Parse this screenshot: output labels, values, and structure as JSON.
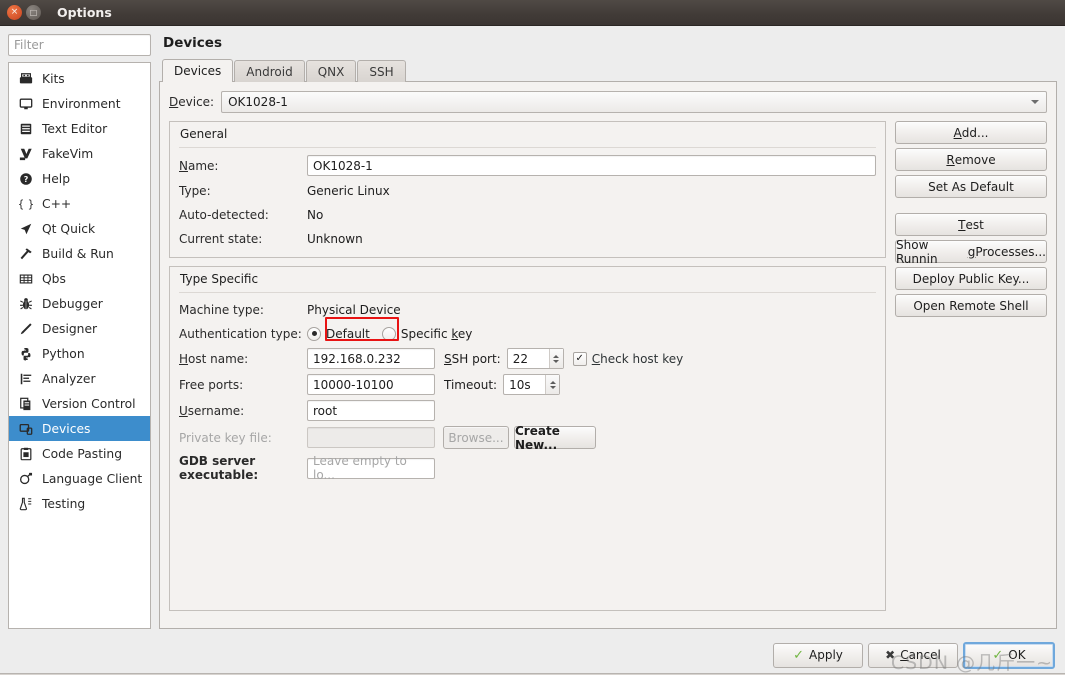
{
  "window": {
    "title": "Options",
    "close_glyph": "×",
    "maximize_glyph": "□"
  },
  "colors": {
    "selection": "#3d8dcc",
    "highlight_box": "#e81313",
    "titlebar": "#413b37",
    "accent_check": "#72b642"
  },
  "sidebar": {
    "filter_placeholder": "Filter",
    "items": [
      {
        "label": "Kits",
        "icon": "kits-icon",
        "selected": false
      },
      {
        "label": "Environment",
        "icon": "monitor-icon",
        "selected": false
      },
      {
        "label": "Text Editor",
        "icon": "text-editor-icon",
        "selected": false
      },
      {
        "label": "FakeVim",
        "icon": "fakevim-icon",
        "selected": false
      },
      {
        "label": "Help",
        "icon": "help-icon",
        "selected": false
      },
      {
        "label": "C++",
        "icon": "braces-icon",
        "selected": false
      },
      {
        "label": "Qt Quick",
        "icon": "qtquick-icon",
        "selected": false
      },
      {
        "label": "Build & Run",
        "icon": "hammer-icon",
        "selected": false
      },
      {
        "label": "Qbs",
        "icon": "grid-icon",
        "selected": false
      },
      {
        "label": "Debugger",
        "icon": "bug-icon",
        "selected": false
      },
      {
        "label": "Designer",
        "icon": "pencil-icon",
        "selected": false
      },
      {
        "label": "Python",
        "icon": "python-icon",
        "selected": false
      },
      {
        "label": "Analyzer",
        "icon": "analyzer-icon",
        "selected": false
      },
      {
        "label": "Version Control",
        "icon": "version-control-icon",
        "selected": false
      },
      {
        "label": "Devices",
        "icon": "devices-icon",
        "selected": true
      },
      {
        "label": "Code Pasting",
        "icon": "code-pasting-icon",
        "selected": false
      },
      {
        "label": "Language Client",
        "icon": "language-client-icon",
        "selected": false
      },
      {
        "label": "Testing",
        "icon": "testing-icon",
        "selected": false
      }
    ]
  },
  "main": {
    "page_title": "Devices",
    "tabs": [
      {
        "label": "Devices",
        "active": true
      },
      {
        "label": "Android",
        "active": false
      },
      {
        "label": "QNX",
        "active": false
      },
      {
        "label": "SSH",
        "active": false
      }
    ],
    "device_row": {
      "label_prefix": "D",
      "label_rest": "evice:",
      "selected_device": "OK1028-1"
    },
    "general": {
      "title": "General",
      "name_label_prefix": "N",
      "name_label_rest": "ame:",
      "name_value": "OK1028-1",
      "type_label": "Type:",
      "type_value": "Generic Linux",
      "autodetected_label": "Auto-detected:",
      "autodetected_value": "No",
      "current_state_label": "Current state:",
      "current_state_value": "Unknown"
    },
    "type_specific": {
      "title": "Type Specific",
      "machine_type_label": "Machine type:",
      "machine_type_value": "Physical Device",
      "auth_label": "Authentication type:",
      "auth_default": "Default",
      "auth_specific_prefix": "Specific ",
      "auth_specific_mnemonic": "k",
      "auth_specific_rest": "ey",
      "auth_selected": "Default",
      "host_label_prefix": "H",
      "host_label_rest": "ost name:",
      "host_value": "192.168.0.232",
      "ssh_port_label_prefix": "S",
      "ssh_port_label_rest": "SH port:",
      "ssh_port_value": "22",
      "check_host_key_prefix": "C",
      "check_host_key_rest": "heck host key",
      "check_host_key_checked": "✓",
      "free_ports_label": "Free ports:",
      "free_ports_value": "10000-10100",
      "timeout_label": "Timeout:",
      "timeout_value": "10s",
      "username_label_prefix": "U",
      "username_label_rest": "sername:",
      "username_value": "root",
      "private_key_label": "Private key file:",
      "private_key_value": "",
      "browse_button": "Browse...",
      "create_new_button": "Create New...",
      "gdb_label": "GDB server executable:",
      "gdb_placeholder": "Leave empty to lo..."
    },
    "side_buttons": [
      {
        "prefix": "",
        "mnemonic": "A",
        "rest": "dd...",
        "separator_after": false
      },
      {
        "prefix": "",
        "mnemonic": "R",
        "rest": "emove",
        "separator_after": false
      },
      {
        "prefix": "Set As Default",
        "mnemonic": "",
        "rest": "",
        "separator_after": true
      },
      {
        "prefix": "",
        "mnemonic": "T",
        "rest": "est",
        "separator_after": false
      },
      {
        "prefix": "Show Runnin",
        "mnemonic": "g",
        "rest": " Processes...",
        "separator_after": false
      },
      {
        "prefix": "Deploy Public Key...",
        "mnemonic": "",
        "rest": "",
        "separator_after": false
      },
      {
        "prefix": "Open Remote Shell",
        "mnemonic": "",
        "rest": "",
        "separator_after": false
      }
    ]
  },
  "footer": {
    "apply": "Apply",
    "cancel_prefix": "",
    "cancel_mnemonic": "C",
    "cancel_rest": "ancel",
    "ok": "OK",
    "apply_icon": "✓",
    "cancel_icon": "✖",
    "ok_icon": "✓",
    "watermark": "CSDN @几斤一~"
  }
}
